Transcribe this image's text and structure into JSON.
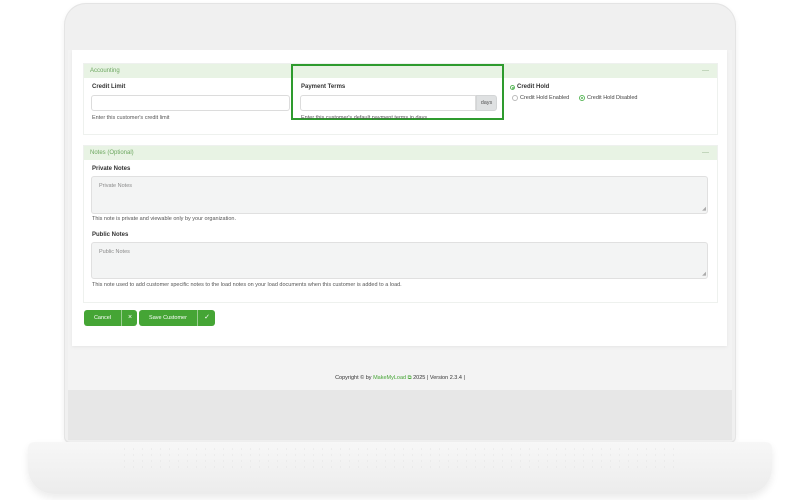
{
  "accounting": {
    "header": "Accounting",
    "collapse": "—",
    "credit_limit": {
      "label": "Credit Limit",
      "value": "",
      "help": "Enter this customer's credit limit"
    },
    "payment_terms": {
      "label": "Payment Terms",
      "value": "",
      "addon": "days",
      "help": "Enter this customer's default payment terms in days"
    },
    "credit_hold": {
      "label": "Credit Hold",
      "options": [
        {
          "label": "Credit Hold Enabled",
          "selected": false
        },
        {
          "label": "Credit Hold Disabled",
          "selected": true
        }
      ]
    }
  },
  "notes": {
    "header": "Notes (Optional)",
    "collapse": "—",
    "private": {
      "label": "Private Notes",
      "placeholder": "Private Notes",
      "help": "This note is private and viewable only by your organization."
    },
    "public": {
      "label": "Public Notes",
      "placeholder": "Public Notes",
      "help": "This note used to add customer specific notes to the load notes on your load documents when this customer is added to a load."
    }
  },
  "actions": {
    "cancel": "Cancel",
    "save": "Save Customer"
  },
  "footer": {
    "prefix": "Copyright © by",
    "brand": "MakeMyLoad",
    "suffix": "2025 | Version 2.3.4 |"
  },
  "colors": {
    "accent": "#45a535",
    "panel_header_bg": "#e8f3e4",
    "highlight": "#2e9b2e"
  }
}
